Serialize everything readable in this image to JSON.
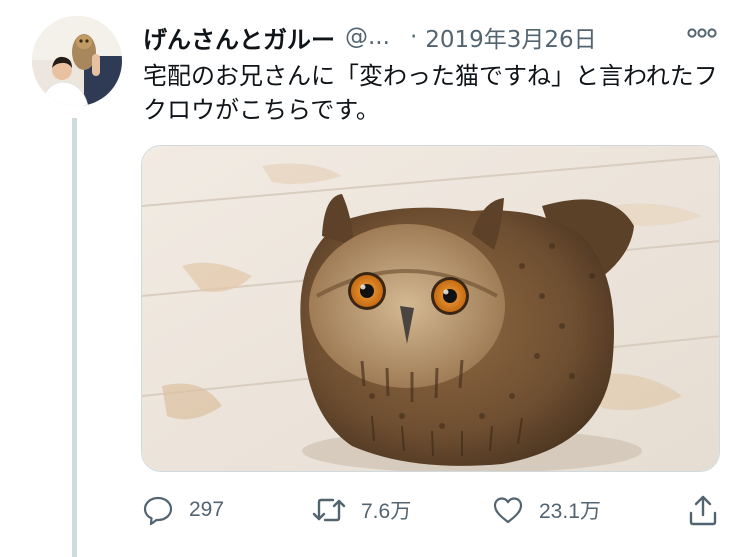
{
  "tweet": {
    "author": {
      "name": "げんさんとガルー",
      "handle": "@...",
      "separator": "·"
    },
    "date": "2019年3月26日",
    "text": "宅配のお兄さんに「変わった猫ですね」と言われたフクロウがこちらです。",
    "media": {
      "subject": "eagle owl sitting on a worn white wooden floor"
    },
    "actions": {
      "replies": "297",
      "retweets": "7.6万",
      "likes": "23.1万"
    },
    "icons": {
      "more": "more-dots-icon",
      "reply": "reply-icon",
      "retweet": "retweet-icon",
      "like": "heart-icon",
      "share": "share-icon"
    },
    "colors": {
      "text": "#0f1419",
      "secondary": "#536471",
      "thread_line": "#cfd9de"
    }
  }
}
